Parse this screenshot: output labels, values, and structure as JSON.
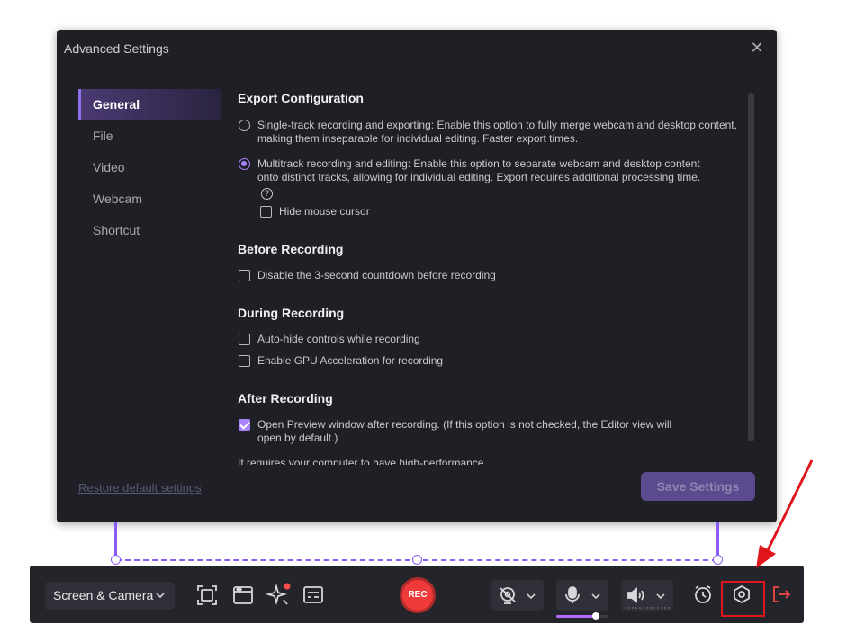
{
  "dialog": {
    "title": "Advanced Settings",
    "close_glyph": "✕",
    "sidebar": [
      "General",
      "File",
      "Video",
      "Webcam",
      "Shortcut"
    ],
    "active_item": "General",
    "restore_label": "Restore default settings",
    "save_label": "Save Settings"
  },
  "content": {
    "export": {
      "title": "Export Configuration",
      "single_track": "Single-track recording and exporting: Enable this option to fully merge webcam and desktop content, making them inseparable for individual editing. Faster export times.",
      "multitrack": "Multitrack recording and editing: Enable this option to separate webcam and desktop content onto distinct tracks, allowing for individual editing. Export requires additional processing time.",
      "help_glyph": "?",
      "hide_cursor": "Hide mouse cursor",
      "selected": "multitrack",
      "hide_cursor_checked": false
    },
    "before": {
      "title": "Before Recording",
      "countdown": "Disable the 3-second countdown before recording",
      "countdown_checked": false
    },
    "during": {
      "title": "During Recording",
      "autohide": "Auto-hide controls while recording",
      "gpu": "Enable GPU Acceleration for recording",
      "autohide_checked": false,
      "gpu_checked": false
    },
    "after": {
      "title": "After Recording",
      "open_preview": "Open Preview window after recording. (If this option is not checked, the Editor view will open by default.)",
      "open_preview_checked": true,
      "note": "It requires your computer to have high-performance"
    }
  },
  "toolbar": {
    "mode_label": "Screen & Camera",
    "rec_label": "REC",
    "mic_level": 0.75
  },
  "colors": {
    "accent": "#a782ff",
    "rec": "#f03a3a",
    "highlight": "#e0161c",
    "notification_dot": "#ff4d4d"
  },
  "icons": [
    "close-icon",
    "chevron-down-icon",
    "fullscreen-capture-icon",
    "window-capture-icon",
    "ai-sparkle-icon",
    "subtitles-icon",
    "camera-off-icon",
    "microphone-icon",
    "speaker-icon",
    "alarm-clock-icon",
    "settings-icon",
    "exit-icon",
    "red-arrow-annotation"
  ]
}
